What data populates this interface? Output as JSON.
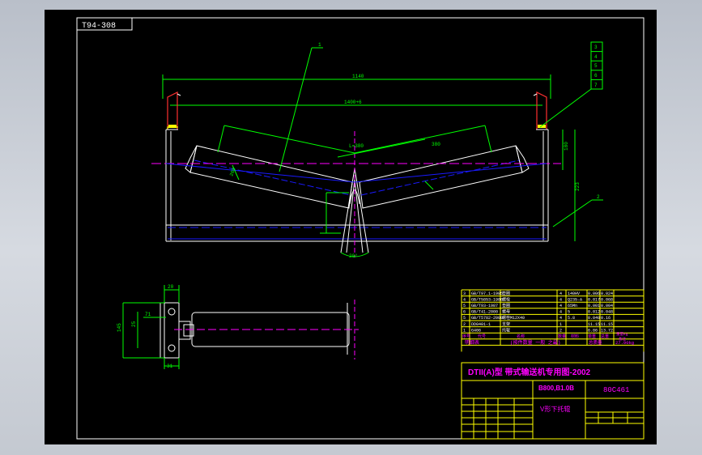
{
  "drawing": {
    "code_box": "T94-308",
    "top_dimension": "1140",
    "inner_dimension": "1400+6",
    "roller_center": "L=380",
    "roller_side": "380",
    "right_height": "180",
    "right_total": "223",
    "angle": "20°",
    "left_dim": "200",
    "leader_top": "1",
    "leader_right": "2",
    "callouts": [
      "3",
      "4",
      "5",
      "6",
      "7"
    ],
    "roller_dims": [
      "145",
      "25",
      "71",
      "20",
      "31"
    ],
    "colors": {
      "white": "#ffffff",
      "green": "#00ff00",
      "blue": "#1a1aff",
      "magenta": "#ff00ff",
      "red": "#ff3030",
      "yellow": "#ffff00"
    }
  },
  "bom": {
    "rows": [
      {
        "no": "3",
        "code": "GB/T97.1-1985",
        "name": "垫圈",
        "qty": "4",
        "mat": "140HV",
        "w1": "0.006",
        "w2": "0.024"
      },
      {
        "no": "4",
        "code": "GB/T5853-1986",
        "name": "螺栓",
        "qty": "4",
        "mat": "Q235-A",
        "w1": "0.017",
        "w2": "0.068"
      },
      {
        "no": "5",
        "code": "GB/T93-1987",
        "name": "垫圈",
        "qty": "4",
        "mat": "65Mn",
        "w1": "0.001",
        "w2": "0.004"
      },
      {
        "no": "6",
        "code": "GB/T41-2000",
        "name": "螺母",
        "qty": "4",
        "mat": "5",
        "w1": "0.012",
        "w2": "0.048"
      },
      {
        "no": "5",
        "code": "GB/T5782-2000",
        "name": "螺栓M12X40",
        "qty": "4",
        "mat": "5.8",
        "w1": "0.040",
        "w2": "0.16"
      },
      {
        "no": "2",
        "code": "DD0401-1",
        "name": "支架",
        "qty": "1",
        "mat": "",
        "w1": "11.15",
        "w2": "11.15"
      },
      {
        "no": "1",
        "code": "G406",
        "name": "托辊",
        "qty": "2",
        "mat": "",
        "w1": "6.86",
        "w2": "13.72"
      }
    ],
    "header": [
      "序号",
      "代号",
      "名称",
      "数量",
      "材料",
      "单重",
      "总重"
    ],
    "header_extra": [
      "重量kg",
      "备注"
    ],
    "summary_label": "明细表",
    "summary_note": "(按件数量 一般 之最)",
    "total_label": "总质量",
    "total_value": "27.90kg"
  },
  "title_block": {
    "standard": "DTII(A)型 带式输送机专用图-2002",
    "part_code": "B800,B1.0B",
    "drawing_no": "80C461",
    "part_name": "V形下托辊"
  }
}
